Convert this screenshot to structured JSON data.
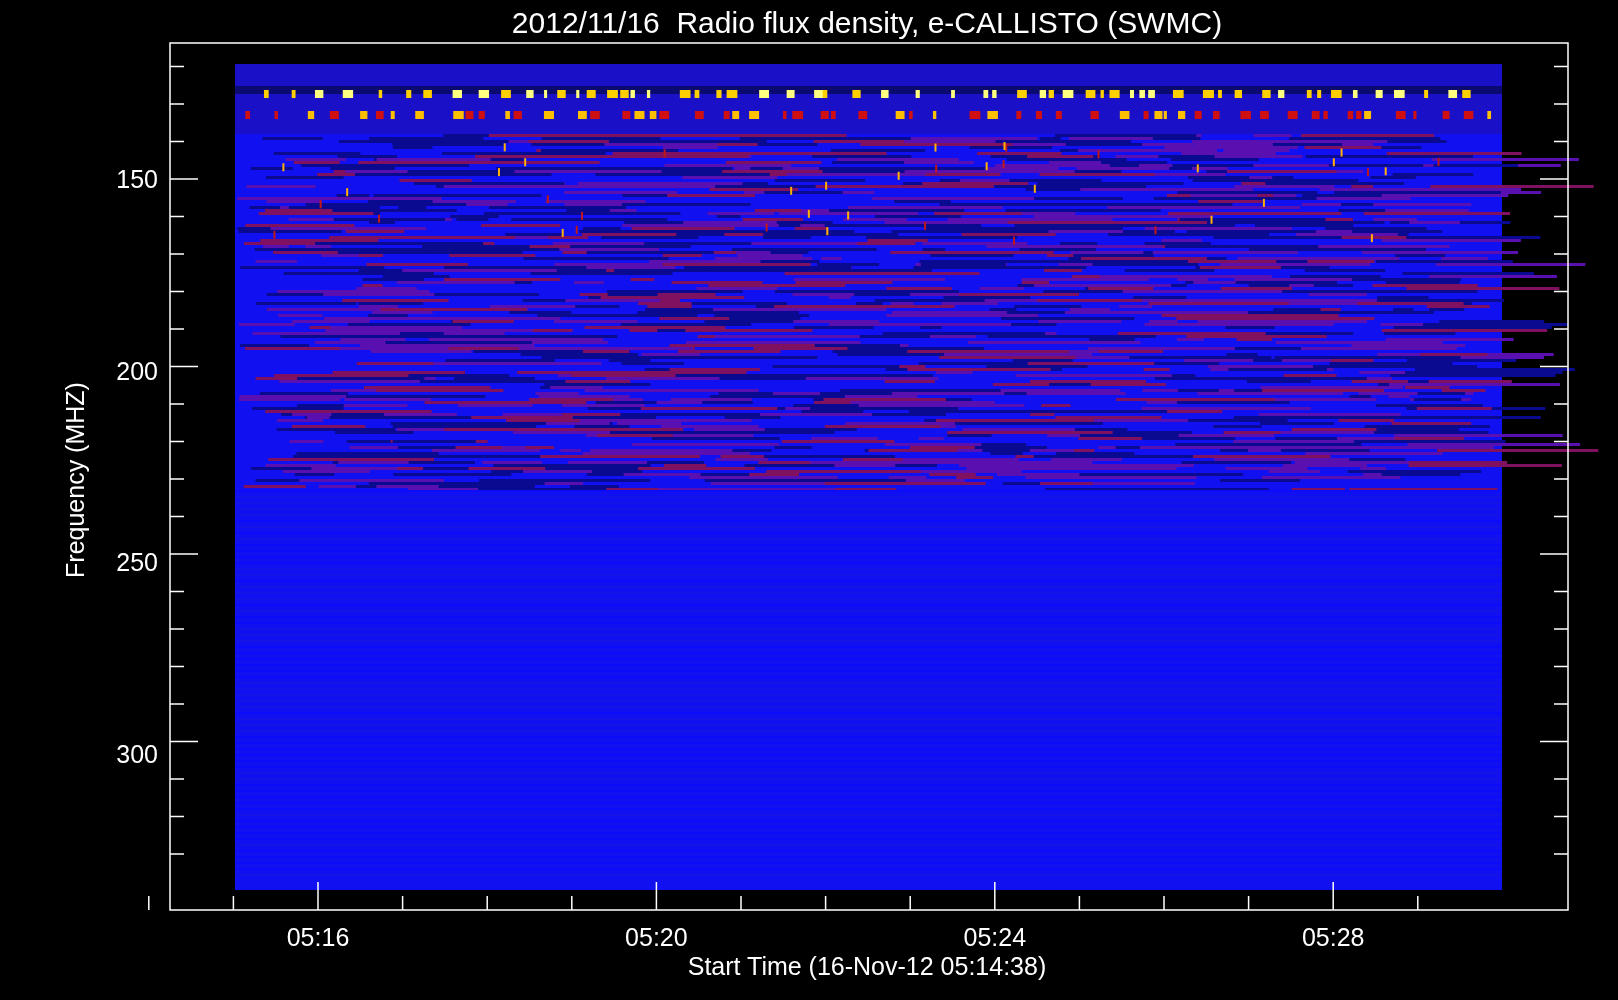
{
  "title": "2012/11/16  Radio flux density, e-CALLISTO (SWMC)",
  "y_axis": {
    "label": "Frequency (MHZ)",
    "ticks": [
      "150",
      "200",
      "250",
      "300"
    ]
  },
  "x_axis": {
    "label": "Start Time (16-Nov-12 05:14:38)",
    "ticks": [
      "05:16",
      "05:20",
      "05:24",
      "05:28"
    ]
  }
}
